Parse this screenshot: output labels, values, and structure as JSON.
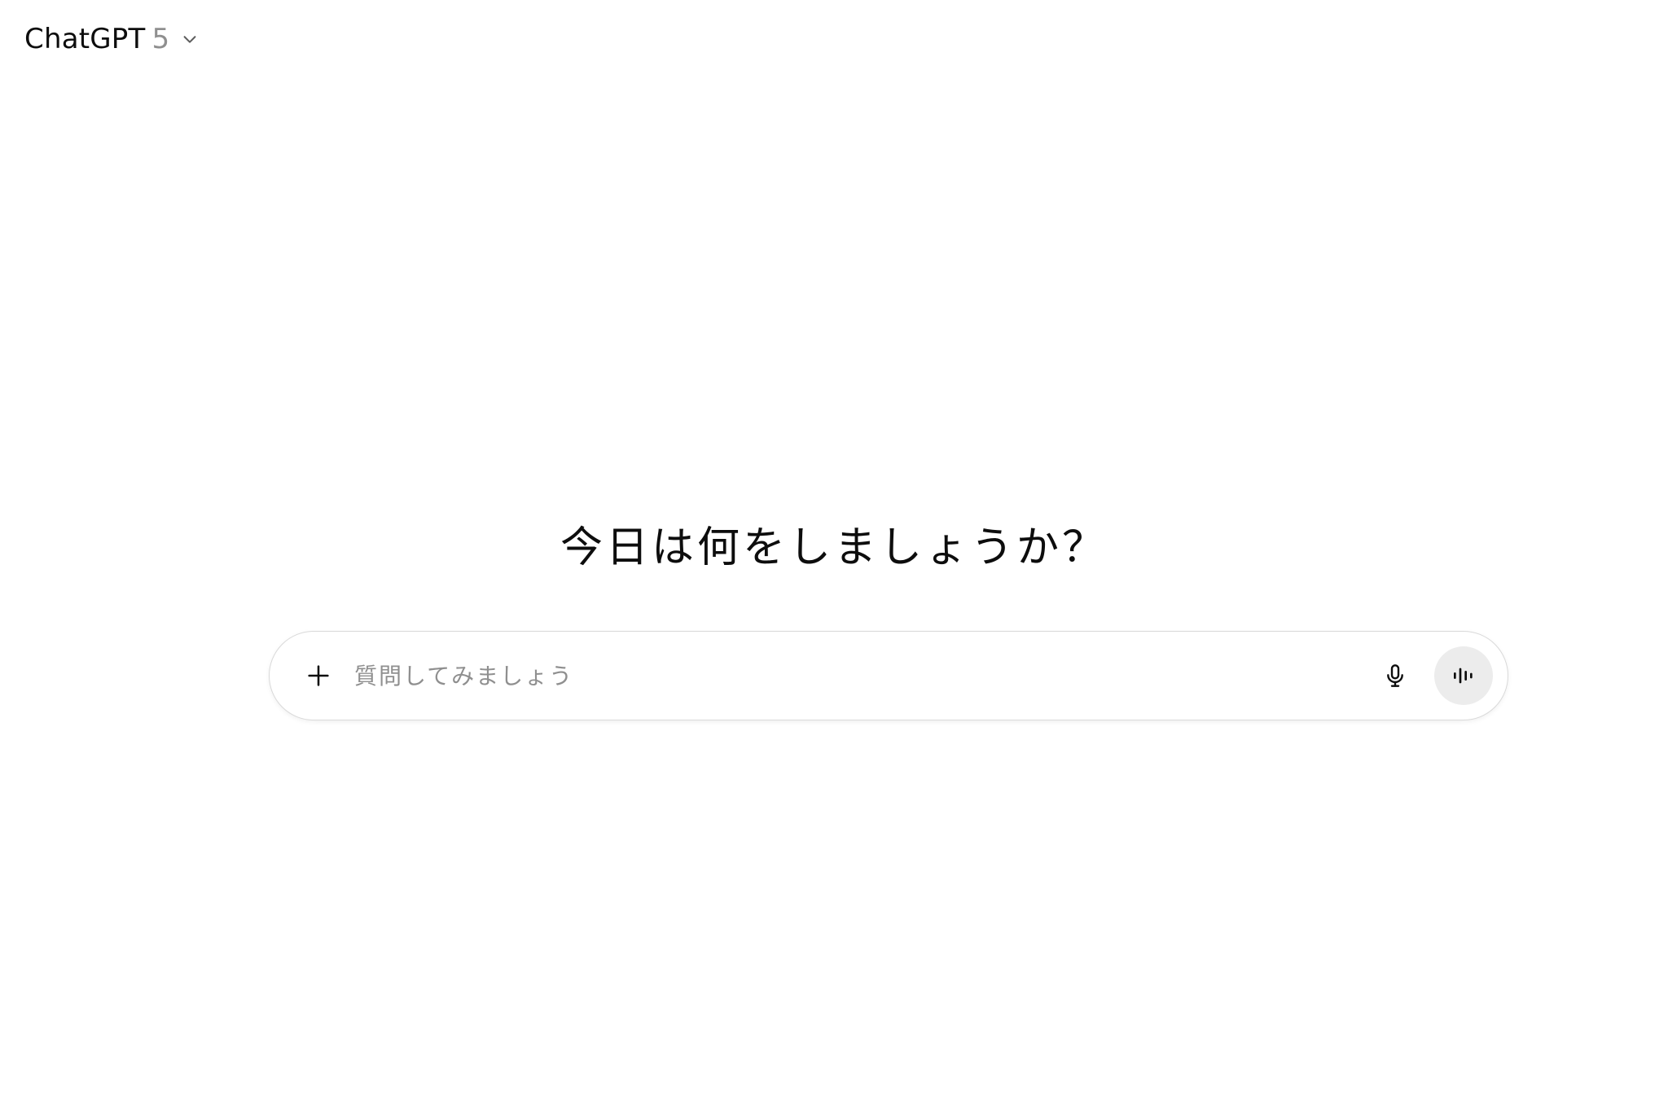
{
  "header": {
    "model_name": "ChatGPT",
    "model_version": "5",
    "dropdown_icon": "chevron-down-icon"
  },
  "main": {
    "greeting": "今日は何をしましょうか？"
  },
  "composer": {
    "placeholder": "質問してみましょう",
    "value": "",
    "add_icon": "plus-icon",
    "dictate_icon": "microphone-icon",
    "voice_icon": "voice-waveform-icon"
  },
  "colors": {
    "text": "#0d0d0d",
    "muted": "#8f8f8f",
    "border": "#d9d9d9",
    "voice_button_bg": "#ececec",
    "background": "#ffffff"
  }
}
